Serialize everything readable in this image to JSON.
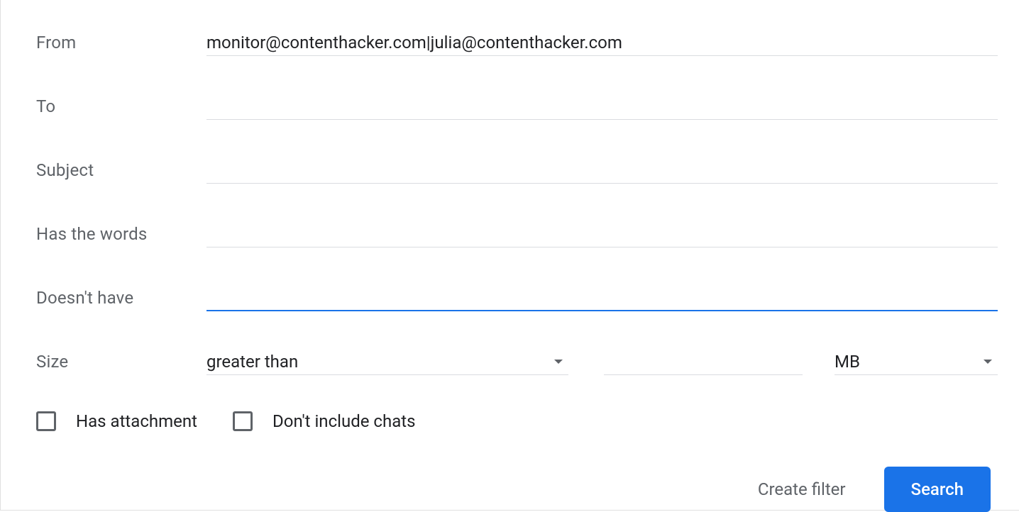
{
  "filter": {
    "from": {
      "label": "From",
      "value": "monitor@contenthacker.com|julia@contenthacker.com"
    },
    "to": {
      "label": "To",
      "value": ""
    },
    "subject": {
      "label": "Subject",
      "value": ""
    },
    "has_words": {
      "label": "Has the words",
      "value": ""
    },
    "doesnt_have": {
      "label": "Doesn't have",
      "value": ""
    },
    "size": {
      "label": "Size",
      "comparison": "greater than",
      "value": "",
      "unit": "MB"
    },
    "has_attachment": {
      "label": "Has attachment",
      "checked": false
    },
    "dont_include_chats": {
      "label": "Don't include chats",
      "checked": false
    }
  },
  "actions": {
    "create_filter": "Create filter",
    "search": "Search"
  }
}
